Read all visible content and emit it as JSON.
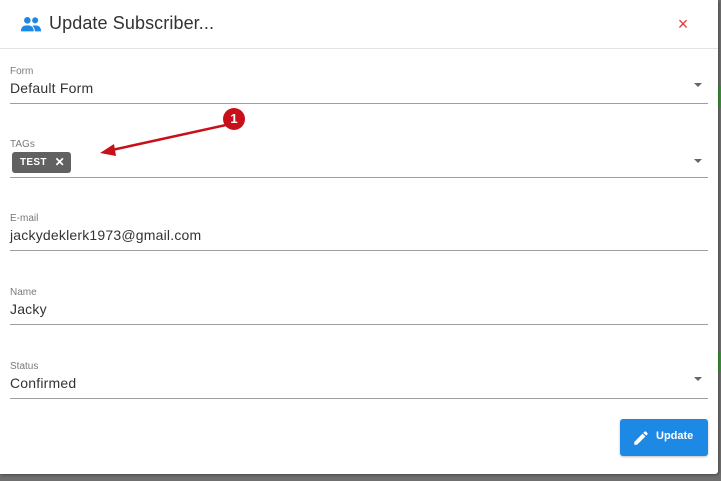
{
  "dialog": {
    "title": "Update Subscriber...",
    "close_glyph": "×",
    "icons": {
      "title_icon": "people-icon",
      "close_icon": "close-icon"
    }
  },
  "fields": {
    "form": {
      "label": "Form",
      "value": "Default Form"
    },
    "tags": {
      "label": "TAGs",
      "chips": [
        {
          "label": "TEST",
          "remove_glyph": "✕"
        }
      ]
    },
    "email": {
      "label": "E-mail",
      "value": "jackydeklerk1973@gmail.com"
    },
    "name": {
      "label": "Name",
      "value": "Jacky"
    },
    "status": {
      "label": "Status",
      "value": "Confirmed"
    }
  },
  "annotation": {
    "number": "1"
  },
  "actions": {
    "update_label": "Update",
    "update_icon": "pencil-icon"
  },
  "colors": {
    "accent": "#1e88e5",
    "close": "#e53935",
    "chip": "#616161",
    "annotation": "#c8101a"
  }
}
